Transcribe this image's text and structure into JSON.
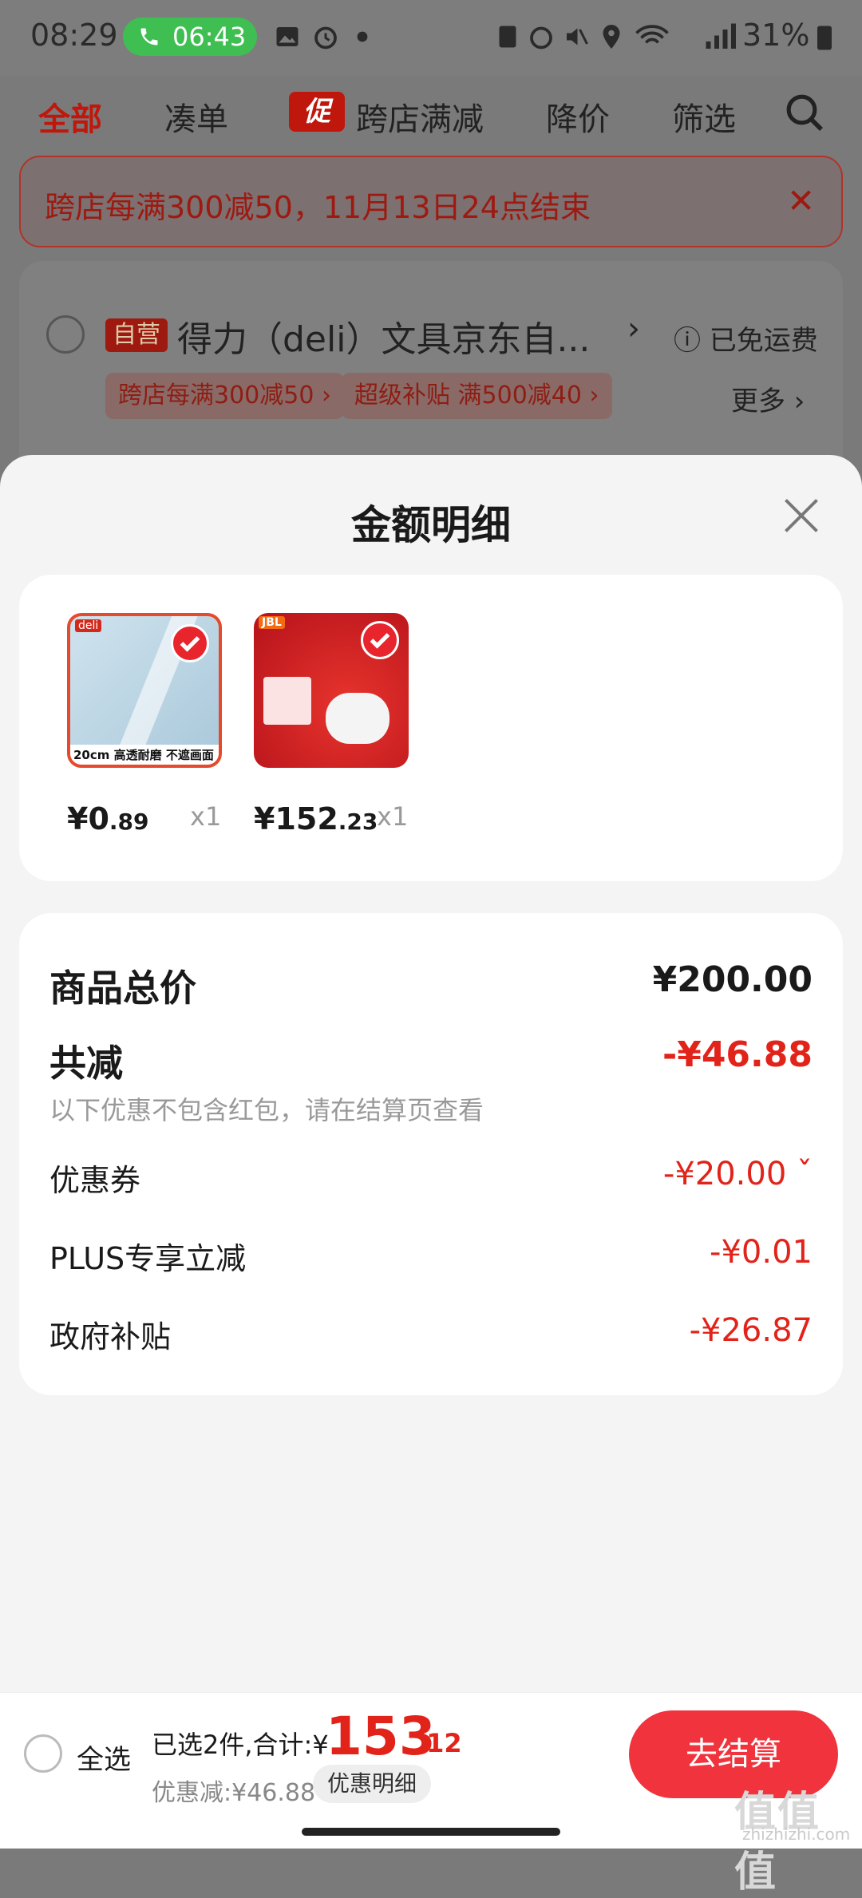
{
  "status_bar": {
    "time": "08:29",
    "call_timer": "06:43",
    "battery_percent": "31%"
  },
  "top_tabs": [
    {
      "label": "全部",
      "active": true
    },
    {
      "label": "凑单"
    },
    {
      "badge": "促",
      "label": "跨店满减"
    },
    {
      "label": "降价"
    },
    {
      "label": "筛选"
    }
  ],
  "promo_banner": {
    "text": "跨店每满300减50，11月13日24点结束",
    "close_glyph": "✕"
  },
  "shop": {
    "self_run_badge": "自营",
    "name": "得力（deli）文具京东自...",
    "arrow": "›",
    "shipping": "ⓘ 已免运费",
    "chips": [
      "跨店每满300减50 ›",
      "超级补贴 满500减40 ›"
    ],
    "more": "更多 ›"
  },
  "sheet": {
    "title": "金额明细",
    "products": [
      {
        "price_int": "¥0",
        "price_dec": ".89",
        "qty": "x1",
        "brand": "deli",
        "caption": "20cm 高透耐磨 不遮画面"
      },
      {
        "price_int": "¥152",
        "price_dec": ".23",
        "qty": "x1",
        "brand": "JBL"
      }
    ],
    "details": {
      "total_label": "商品总价",
      "total_value": "¥200.00",
      "discount_label": "共减",
      "discount_value": "-¥46.88",
      "note": "以下优惠不包含红包，请在结算页查看",
      "items": [
        {
          "label": "优惠券",
          "value": "-¥20.00 ˇ"
        },
        {
          "label": "PLUS专享立减",
          "value": "-¥0.01"
        },
        {
          "label": "政府补贴",
          "value": "-¥26.87"
        }
      ]
    }
  },
  "bottom_bar": {
    "select_all": "全选",
    "selected_text": "已选2件,合计:¥",
    "sum_int": "153",
    "sum_dec": ".12",
    "saving": "优惠减:¥46.88",
    "detail_button": "优惠明细",
    "checkout_button": "去结算"
  },
  "watermark": {
    "main": "值值值",
    "sub": "zhizhizhi.com"
  },
  "colors": {
    "accent": "#e2231a",
    "checkout": "#f0333c",
    "call": "#3fbf52"
  }
}
